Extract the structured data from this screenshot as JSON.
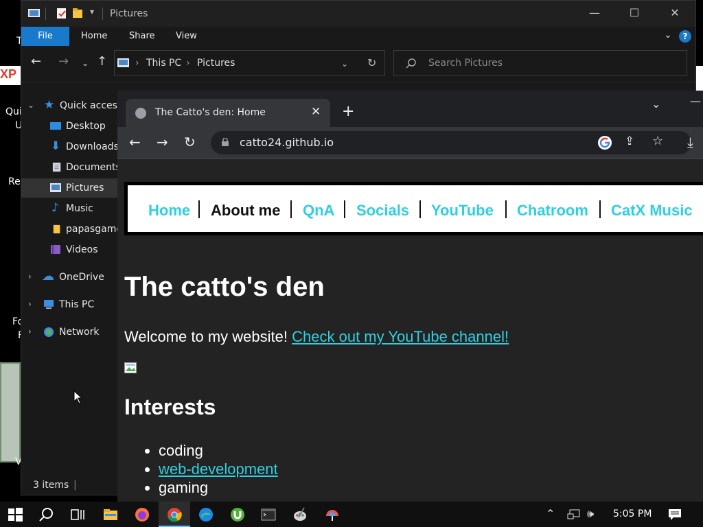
{
  "desktop": {
    "fragments": [
      "T",
      "XP",
      "Qui",
      "U",
      "Re",
      "Fo",
      "F",
      "V"
    ]
  },
  "explorer": {
    "title": "Pictures",
    "ribbon": {
      "file": "File",
      "tabs": [
        "Home",
        "Share",
        "View"
      ]
    },
    "address": {
      "root": "This PC",
      "current": "Pictures"
    },
    "search_placeholder": "Search Pictures",
    "nav": {
      "quick_access": "Quick access",
      "items": [
        "Desktop",
        "Downloads",
        "Documents",
        "Pictures",
        "Music",
        "papasgame",
        "Videos"
      ],
      "onedrive": "OneDrive",
      "this_pc": "This PC",
      "network": "Network"
    },
    "status": "3 items"
  },
  "browser": {
    "tab_title": "The Catto's den: Home",
    "url": "catto24.github.io"
  },
  "webpage": {
    "nav": [
      "Home",
      "About me",
      "QnA",
      "Socials",
      "YouTube",
      "Chatroom",
      "CatX Music"
    ],
    "title": "The catto's den",
    "welcome": "Welcome to my website!",
    "youtube_link": "Check out my YouTube channel!",
    "interests_heading": "Interests",
    "interests": [
      "coding",
      "web-development",
      "gaming"
    ],
    "colors": {
      "link": "#2fcfe0",
      "background": "#232323"
    }
  },
  "taskbar": {
    "time": "5:05 PM",
    "icons": [
      "windows-start-icon",
      "search-icon",
      "task-view-icon",
      "file-explorer-icon",
      "firefox-icon",
      "chrome-icon",
      "edge-icon",
      "utorrent-icon",
      "terminal-icon",
      "paint-icon",
      "paint-3d-icon"
    ]
  }
}
